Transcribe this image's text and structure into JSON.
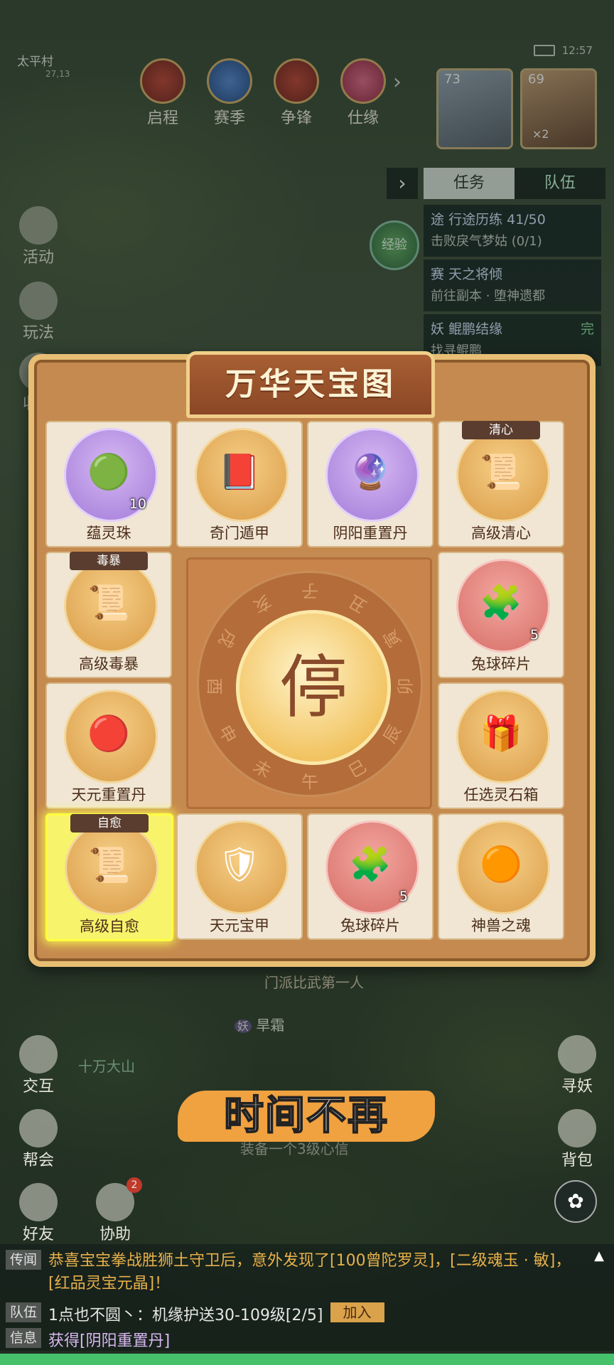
{
  "status": {
    "time": "12:57"
  },
  "location": {
    "name": "太平村",
    "coords": "27,13"
  },
  "top_menu": [
    {
      "label": "启程",
      "icon": "scroll-icon"
    },
    {
      "label": "赛季",
      "icon": "season-icon"
    },
    {
      "label": "争锋",
      "icon": "flag-icon"
    },
    {
      "label": "仕缘",
      "icon": "lantern-icon"
    }
  ],
  "party": [
    {
      "level": "73"
    },
    {
      "level": "69",
      "badge": "×2"
    }
  ],
  "panel_tabs": {
    "task": "任务",
    "team": "队伍"
  },
  "tasks": [
    {
      "tag": "途",
      "title": "行途历练 41/50",
      "sub": "击败戾气梦姑 (0/1)"
    },
    {
      "tag": "赛",
      "title": "天之将倾",
      "sub": "前往副本 · 堕神遗都"
    },
    {
      "tag": "妖",
      "title": "鲲鹏结缘",
      "sub": "找寻鲲鹏",
      "badge": "完"
    }
  ],
  "exp_label": "经验",
  "left_menu": [
    "活动",
    "玩法",
    "收益"
  ],
  "modal": {
    "title": "万华天宝图",
    "items": [
      {
        "name": "蕴灵珠",
        "count": "10",
        "tag": "",
        "icon": "jade-orb-icon",
        "glyph": "🟢",
        "disc": "purple"
      },
      {
        "name": "奇门遁甲",
        "count": "",
        "tag": "",
        "icon": "book-icon",
        "glyph": "📕",
        "disc": "gold"
      },
      {
        "name": "阴阳重置丹",
        "count": "",
        "tag": "",
        "icon": "purple-orb-icon",
        "glyph": "🔮",
        "disc": "purple"
      },
      {
        "name": "高级清心",
        "count": "",
        "tag": "清心",
        "icon": "scroll-icon",
        "glyph": "📜",
        "disc": "gold"
      },
      {
        "name": "高级毒暴",
        "count": "",
        "tag": "毒暴",
        "icon": "scroll-icon",
        "glyph": "📜",
        "disc": "gold"
      },
      {
        "name": "兔球碎片",
        "count": "5",
        "tag": "",
        "icon": "bunny-puzzle-icon",
        "glyph": "🧩",
        "disc": "red"
      },
      {
        "name": "天元重置丹",
        "count": "",
        "tag": "",
        "icon": "red-orb-icon",
        "glyph": "🔴",
        "disc": "gold"
      },
      {
        "name": "任选灵石箱",
        "count": "",
        "tag": "",
        "icon": "gift-box-icon",
        "glyph": "🎁",
        "disc": "gold"
      },
      {
        "name": "高级自愈",
        "count": "",
        "tag": "自愈",
        "icon": "scroll-icon",
        "glyph": "📜",
        "disc": "gold",
        "highlight": true
      },
      {
        "name": "天元宝甲",
        "count": "",
        "tag": "",
        "icon": "armor-icon",
        "glyph": "🛡",
        "disc": "gold"
      },
      {
        "name": "兔球碎片",
        "count": "5",
        "tag": "",
        "icon": "bunny-puzzle-icon",
        "glyph": "🧩",
        "disc": "red"
      },
      {
        "name": "神兽之魂",
        "count": "",
        "tag": "",
        "icon": "fire-orb-icon",
        "glyph": "🟠",
        "disc": "gold"
      }
    ],
    "stop_label": "停",
    "zodiac": [
      "子",
      "丑",
      "寅",
      "卯",
      "辰",
      "巳",
      "午",
      "未",
      "申",
      "酉",
      "戌",
      "亥"
    ]
  },
  "scene_labels": {
    "rank": "门派比武第一人",
    "npc": "旱霜",
    "region": "十万大山",
    "equip_hint": "装备一个3级心信"
  },
  "subtitle": "时间不再",
  "left_bottom": [
    "交互",
    "帮会",
    "好友",
    "协助"
  ],
  "help_badge": "2",
  "right_bottom": [
    "寻妖",
    "背包"
  ],
  "chat": [
    {
      "label": "传闻",
      "text": "恭喜宝宝拳战胜狮土守卫后，意外发现了[100曾陀罗灵]，[二级魂玉 · 敏]，[红品灵宝元晶]！"
    },
    {
      "label": "队伍",
      "text": "1点也不圆丶：机缘护送30-109级[2/5]",
      "action": "加入"
    },
    {
      "label": "信息",
      "text": "获得[阴阳重置丹]"
    }
  ],
  "colors": {
    "frame": "#e7be74",
    "highlight": "#f7f36a",
    "subtitle_bg": "#f0a140"
  }
}
